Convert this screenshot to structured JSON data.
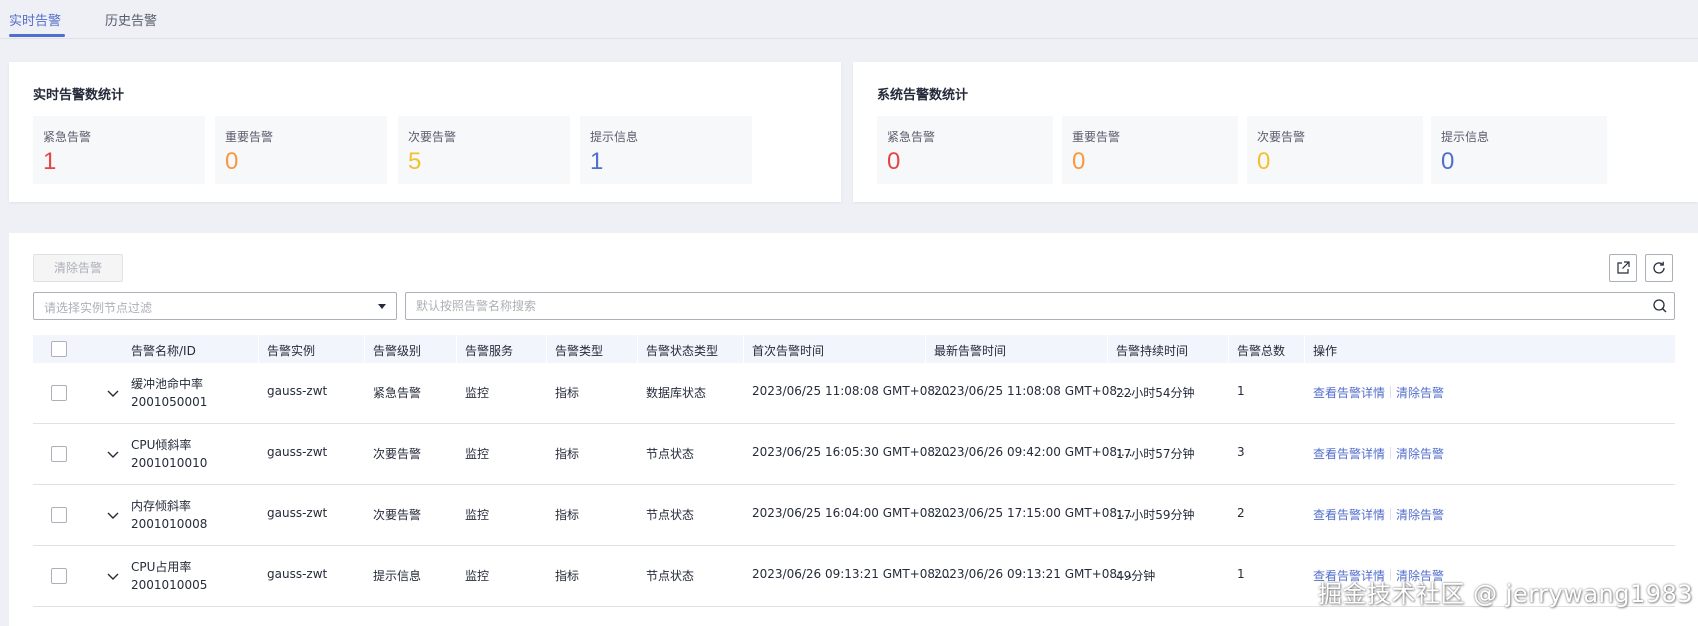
{
  "tabs": [
    "实时告警",
    "历史告警"
  ],
  "realtime_panel": {
    "title": "实时告警数统计",
    "cards": [
      {
        "label": "紧急告警",
        "value": "1",
        "color": "#e54545"
      },
      {
        "label": "重要告警",
        "value": "0",
        "color": "#fa9841"
      },
      {
        "label": "次要告警",
        "value": "5",
        "color": "#f3c130"
      },
      {
        "label": "提示信息",
        "value": "1",
        "color": "#526ecc"
      }
    ]
  },
  "system_panel": {
    "title": "系统告警数统计",
    "cards": [
      {
        "label": "紧急告警",
        "value": "0",
        "color": "#e54545"
      },
      {
        "label": "重要告警",
        "value": "0",
        "color": "#fa9841"
      },
      {
        "label": "次要告警",
        "value": "0",
        "color": "#f3c130"
      },
      {
        "label": "提示信息",
        "value": "0",
        "color": "#526ecc"
      }
    ]
  },
  "toolbar": {
    "clear_label": "清除告警",
    "node_filter_placeholder": "请选择实例节点过滤",
    "search_placeholder": "默认按照告警名称搜索"
  },
  "table": {
    "headers": [
      "告警名称/ID",
      "告警实例",
      "告警级别",
      "告警服务",
      "告警类型",
      "告警状态类型",
      "首次告警时间",
      "最新告警时间",
      "告警持续时间",
      "告警总数",
      "操作"
    ],
    "action_detail": "查看告警详情",
    "action_clear": "清除告警",
    "rows": [
      {
        "name": "缓冲池命中率",
        "id": "2001050001",
        "instance": "gauss-zwt",
        "level": "紧急告警",
        "service": "监控",
        "type": "指标",
        "state_type": "数据库状态",
        "first_time": "2023/06/25 11:08:08 GMT+08:...",
        "latest_time": "2023/06/25 11:08:08 GMT+08:...",
        "duration": "22小时54分钟",
        "count": "1"
      },
      {
        "name": "CPU倾斜率",
        "id": "2001010010",
        "instance": "gauss-zwt",
        "level": "次要告警",
        "service": "监控",
        "type": "指标",
        "state_type": "节点状态",
        "first_time": "2023/06/25 16:05:30 GMT+08:...",
        "latest_time": "2023/06/26 09:42:00 GMT+08:...",
        "duration": "17小时57分钟",
        "count": "3"
      },
      {
        "name": "内存倾斜率",
        "id": "2001010008",
        "instance": "gauss-zwt",
        "level": "次要告警",
        "service": "监控",
        "type": "指标",
        "state_type": "节点状态",
        "first_time": "2023/06/25 16:04:00 GMT+08:...",
        "latest_time": "2023/06/25 17:15:00 GMT+08:...",
        "duration": "17小时59分钟",
        "count": "2"
      },
      {
        "name": "CPU占用率",
        "id": "2001010005",
        "instance": "gauss-zwt",
        "level": "提示信息",
        "service": "监控",
        "type": "指标",
        "state_type": "节点状态",
        "first_time": "2023/06/26 09:13:21 GMT+08:...",
        "latest_time": "2023/06/26 09:13:21 GMT+08:...",
        "duration": "49分钟",
        "count": "1"
      }
    ]
  },
  "watermark": "掘金技术社区 @ jerrywang1983",
  "icons": {
    "export": "export-icon",
    "refresh": "refresh-icon",
    "search": "search-icon",
    "expand": "chevron-down-icon",
    "dropdown": "caret-down-icon"
  }
}
